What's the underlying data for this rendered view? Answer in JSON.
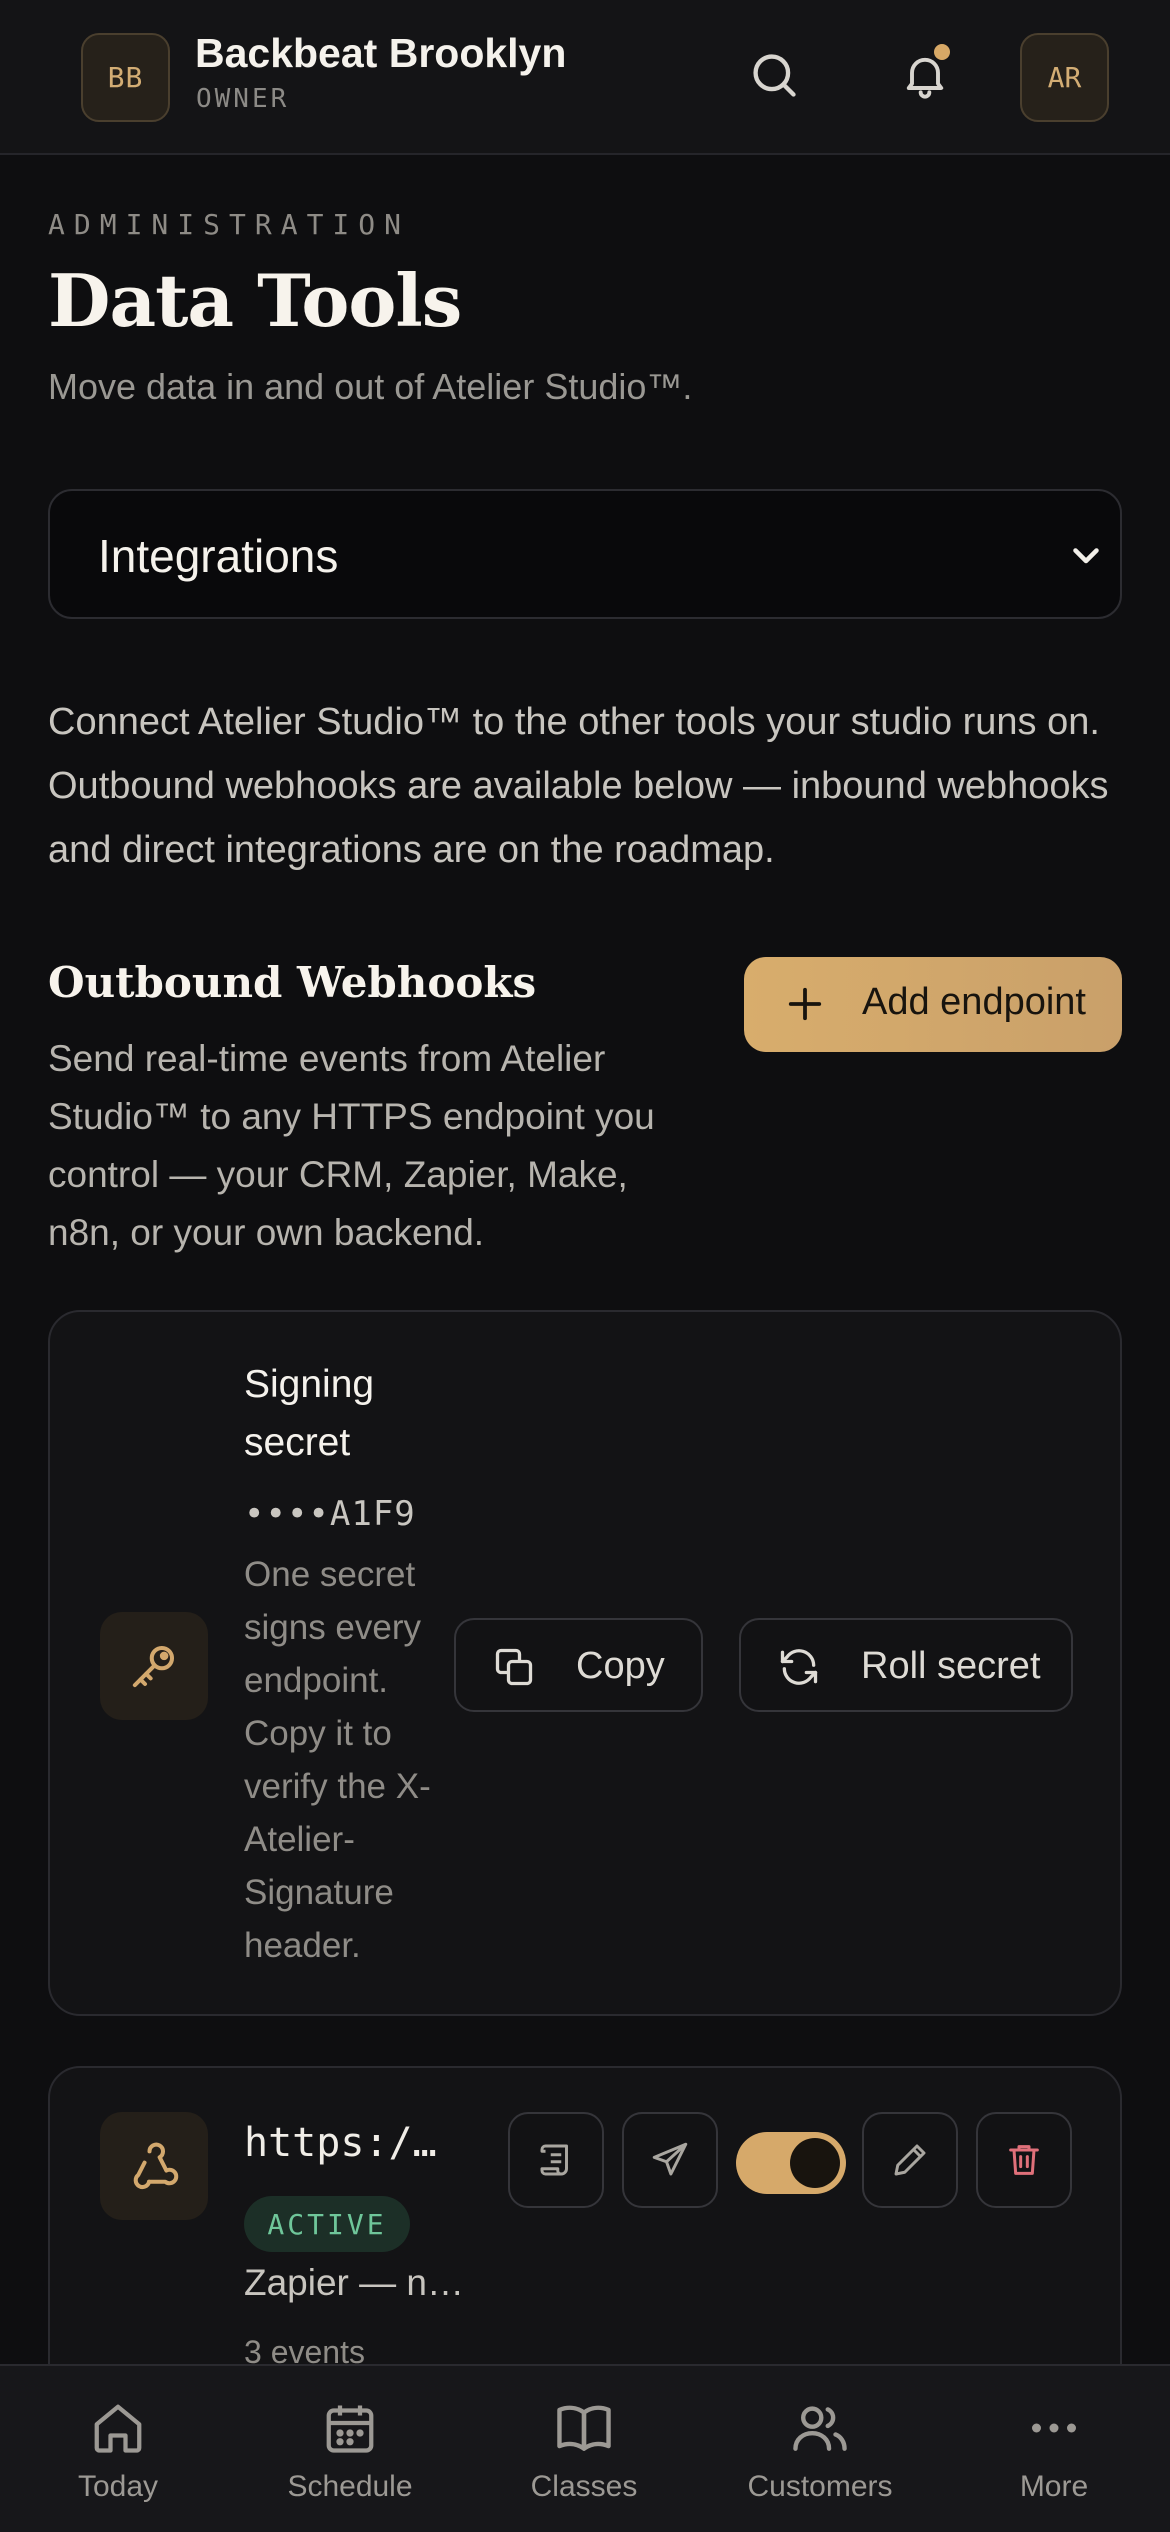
{
  "header": {
    "org_initials": "BB",
    "org_name": "Backbeat Brooklyn",
    "role": "OWNER",
    "user_initials": "AR"
  },
  "page": {
    "eyebrow": "ADMINISTRATION",
    "title": "Data Tools",
    "subtitle": "Move data in and out of Atelier Studio™."
  },
  "section_select": {
    "value": "Integrations"
  },
  "intro": "Connect Atelier Studio™ to the other tools your studio runs on. Outbound webhooks are available below — inbound webhooks and direct integrations are on the roadmap.",
  "webhooks": {
    "title": "Outbound Webhooks",
    "description": "Send real-time events from Atelier Studio™ to any HTTPS endpoint you control — your CRM, Zapier, Make, n8n, or your own backend.",
    "add_label": "Add endpoint"
  },
  "signing_secret": {
    "title": "Signing secret",
    "masked": "••••A1F9",
    "help": "One secret signs every endpoint. Copy it to verify the X-Atelier-Signature header.",
    "copy_label": "Copy",
    "roll_label": "Roll secret"
  },
  "endpoint": {
    "url": "https://…",
    "status": "ACTIVE",
    "description": "Zapier — ne…",
    "events": "3 events",
    "enabled": true
  },
  "nav": {
    "items": [
      {
        "label": "Today",
        "icon": "home-icon"
      },
      {
        "label": "Schedule",
        "icon": "calendar-icon"
      },
      {
        "label": "Classes",
        "icon": "book-icon"
      },
      {
        "label": "Customers",
        "icon": "users-icon"
      },
      {
        "label": "More",
        "icon": "more-icon"
      }
    ]
  },
  "colors": {
    "background": "#0e0e10",
    "accent": "#d6a96a",
    "active_badge": "#6fc69a",
    "delete": "#e0707a"
  }
}
